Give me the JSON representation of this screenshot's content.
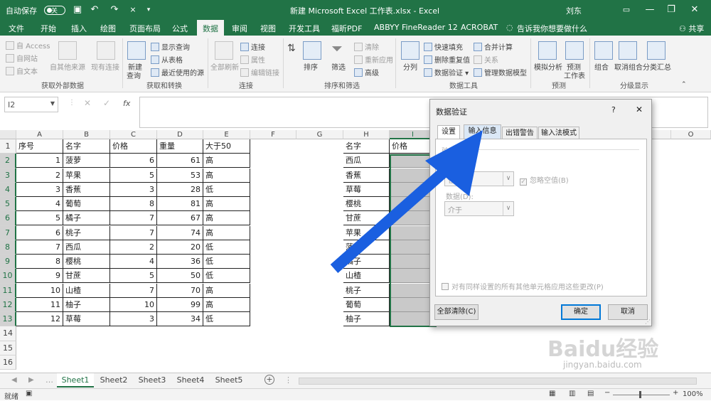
{
  "titlebar": {
    "autosave": "自动保存",
    "autosave_state": "关",
    "title": "新建 Microsoft Excel 工作表.xlsx  -  Excel",
    "user": "刘东",
    "undo": "↶",
    "redo": "↷",
    "minimize": "—",
    "restore": "❐",
    "close": "✕"
  },
  "tabs": [
    {
      "label": "文件"
    },
    {
      "label": "开始"
    },
    {
      "label": "插入"
    },
    {
      "label": "绘图"
    },
    {
      "label": "页面布局"
    },
    {
      "label": "公式"
    },
    {
      "label": "数据"
    },
    {
      "label": "审阅"
    },
    {
      "label": "视图"
    },
    {
      "label": "开发工具"
    },
    {
      "label": "福昕PDF"
    },
    {
      "label": "ABBYY FineReader 12"
    },
    {
      "label": "ACROBAT"
    }
  ],
  "tell_me": "告诉我你想要做什么",
  "share": "共享",
  "ribbon": {
    "get_external": {
      "access": "自 Access",
      "web": "自网站",
      "text": "自文本",
      "other": "自其他来源",
      "existing": "现有连接",
      "group": "获取外部数据"
    },
    "get_transform": {
      "new_query": "新建",
      "new_query2": "查询",
      "show_queries": "显示查询",
      "from_table": "从表格",
      "recent": "最近使用的源",
      "group": "获取和转换"
    },
    "connections": {
      "refresh_all": "全部刷新",
      "connections": "连接",
      "properties": "属性",
      "edit_links": "编辑链接",
      "group": "连接"
    },
    "sort_filter": {
      "sort": "排序",
      "filter": "筛选",
      "clear": "清除",
      "reapply": "重新应用",
      "advanced": "高级",
      "group": "排序和筛选"
    },
    "data_tools": {
      "split": "分列",
      "flash_fill": "快速填充",
      "remove_dup": "删除重复值",
      "validation": "数据验证",
      "consolidate": "合并计算",
      "relations": "关系",
      "manage_model": "管理数据模型",
      "group": "数据工具"
    },
    "forecast": {
      "what_if": "模拟分析",
      "forecast_sheet": "预测",
      "forecast_sheet2": "工作表",
      "group": "预测"
    },
    "outline": {
      "group_btn": "组合",
      "ungroup": "取消组合",
      "subtotal": "分类汇总",
      "group": "分级显示"
    }
  },
  "formula_bar": {
    "name_box": "I2",
    "fx": "fx"
  },
  "columns": [
    "A",
    "B",
    "C",
    "D",
    "E",
    "F",
    "G",
    "H",
    "I",
    "O"
  ],
  "rows": [
    "1",
    "2",
    "3",
    "4",
    "5",
    "6",
    "7",
    "8",
    "9",
    "10",
    "11",
    "12",
    "13",
    "14",
    "15",
    "16"
  ],
  "table1": {
    "headers": [
      "序号",
      "名字",
      "价格",
      "重量",
      "大于50"
    ],
    "rows": [
      [
        "1",
        "菠萝",
        "6",
        "61",
        "高"
      ],
      [
        "2",
        "苹果",
        "5",
        "53",
        "高"
      ],
      [
        "3",
        "香蕉",
        "3",
        "28",
        "低"
      ],
      [
        "4",
        "葡萄",
        "8",
        "81",
        "高"
      ],
      [
        "5",
        "橘子",
        "7",
        "67",
        "高"
      ],
      [
        "6",
        "桃子",
        "7",
        "74",
        "高"
      ],
      [
        "7",
        "西瓜",
        "2",
        "20",
        "低"
      ],
      [
        "8",
        "樱桃",
        "4",
        "36",
        "低"
      ],
      [
        "9",
        "甘蔗",
        "5",
        "50",
        "低"
      ],
      [
        "10",
        "山楂",
        "7",
        "70",
        "高"
      ],
      [
        "11",
        "柚子",
        "10",
        "99",
        "高"
      ],
      [
        "12",
        "草莓",
        "3",
        "34",
        "低"
      ]
    ]
  },
  "table2": {
    "headers": [
      "名字",
      "价格"
    ],
    "names": [
      "西瓜",
      "香蕉",
      "草莓",
      "樱桃",
      "甘蔗",
      "苹果",
      "菠萝",
      "橘子",
      "山楂",
      "桃子",
      "葡萄",
      "柚子"
    ]
  },
  "sheets": [
    {
      "label": "Sheet1"
    },
    {
      "label": "Sheet2"
    },
    {
      "label": "Sheet3"
    },
    {
      "label": "Sheet4"
    },
    {
      "label": "Sheet5"
    }
  ],
  "status": {
    "ready": "就绪",
    "zoom": "100%"
  },
  "dialog": {
    "title": "数据验证",
    "help": "?",
    "close": "✕",
    "tabs": [
      {
        "label": "设置"
      },
      {
        "label": "输入信息"
      },
      {
        "label": "出错警告"
      },
      {
        "label": "输入法模式"
      }
    ],
    "criteria_label": "验证条件",
    "allow_label": "允许(A):",
    "allow_value": "任何值",
    "ignore_blank": "忽略空值(B)",
    "data_label": "数据(D):",
    "data_value": "介于",
    "apply_all": "对有同样设置的所有其他单元格应用这些更改(P)",
    "clear_all": "全部清除(C)",
    "ok": "确定",
    "cancel": "取消"
  },
  "watermark": {
    "brand": "Baidu经验",
    "url": "jingyan.baidu.com"
  },
  "colors": {
    "excel_green": "#217346",
    "arrow_blue": "#1a5fe0"
  }
}
